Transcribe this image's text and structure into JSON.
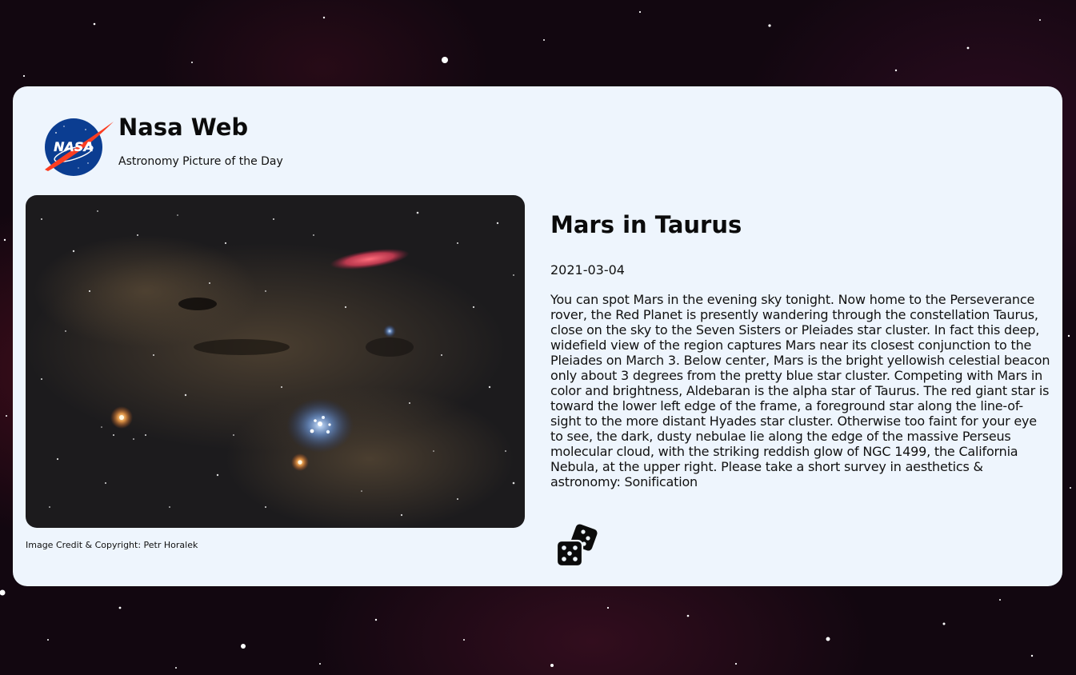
{
  "header": {
    "logo_text": "NASA",
    "title": "Nasa Web",
    "subtitle": "Astronomy Picture of the Day"
  },
  "apod": {
    "credit": "Image Credit & Copyright: Petr Horalek",
    "title": "Mars in Taurus",
    "date": "2021-03-04",
    "explanation": "You can spot Mars in the evening sky tonight. Now home to the Perseverance rover, the Red Planet is presently wandering through the constellation Taurus, close on the sky to the Seven Sisters or Pleiades star cluster. In fact this deep, widefield view of the region captures Mars near its closest conjunction to the Pleiades on March 3. Below center, Mars is the bright yellowish celestial beacon only about 3 degrees from the pretty blue star cluster. Competing with Mars in color and brightness, Aldebaran is the alpha star of Taurus. The red giant star is toward the lower left edge of the frame, a foreground star along the line-of-sight to the more distant Hyades star cluster. Otherwise too faint for your eye to see, the dark, dusty nebulae lie along the edge of the massive Perseus molecular cloud, with the striking reddish glow of NGC 1499, the California Nebula, at the upper right. Please take a short survey in aesthetics & astronomy: Sonification"
  },
  "actions": {
    "random_icon": "dice-icon"
  },
  "colors": {
    "card_background": "#eef5fd",
    "text": "#0b0b0b",
    "nasa_blue": "#0b3d91",
    "nasa_red": "#fc3d21"
  }
}
